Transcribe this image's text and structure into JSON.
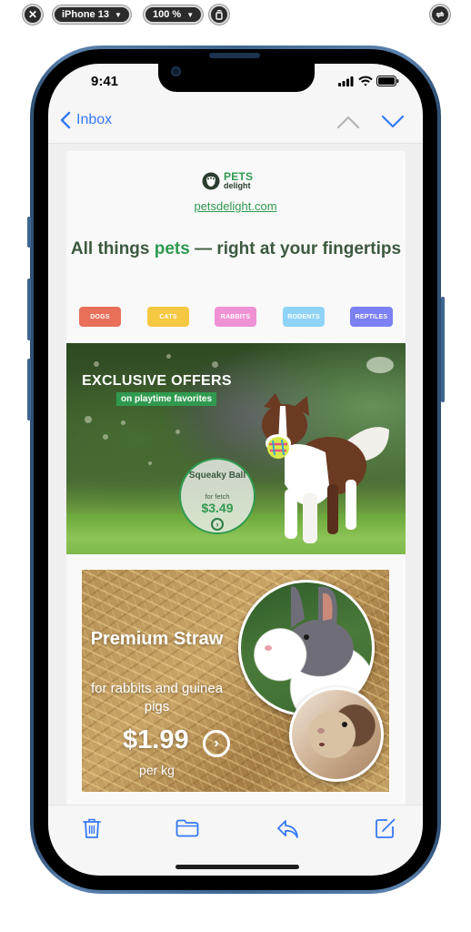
{
  "simulator": {
    "device_label": "iPhone 13",
    "zoom_label": "100 %",
    "close_icon": "close-icon",
    "rotate_icon": "rotate-icon",
    "sync_icon": "sync-icon"
  },
  "status_bar": {
    "time": "9:41",
    "icons": [
      "cellular-signal-icon",
      "wifi-icon",
      "battery-icon"
    ]
  },
  "nav": {
    "back_label": "Inbox",
    "prev_icon": "chevron-up-icon",
    "next_icon": "chevron-down-icon"
  },
  "email": {
    "brand": {
      "name_top": "PETS",
      "name_bottom": "delight",
      "link": "petsdelight.com"
    },
    "headline": {
      "before": "All things ",
      "highlight": "pets",
      "after": " — right at your fingertips"
    },
    "categories": [
      {
        "label": "DOGS",
        "color": "#e8705a"
      },
      {
        "label": "CATS",
        "color": "#f5c842"
      },
      {
        "label": "RABBITS",
        "color": "#ee92d4"
      },
      {
        "label": "RODENTS",
        "color": "#8fd3f7"
      },
      {
        "label": "REPTILES",
        "color": "#7b80f2"
      }
    ],
    "hero": {
      "title": "EXCLUSIVE OFFERS",
      "subtitle": "on playtime favorites",
      "product_name": "Squeaky Ball",
      "product_desc": "for fetch",
      "product_price": "$3.49",
      "arrow": "›"
    },
    "straw_offer": {
      "title": "Premium Straw",
      "subtitle": "for rabbits and guinea pigs",
      "price": "$1.99",
      "unit": "per kg",
      "arrow": "›"
    }
  },
  "toolbar": {
    "items": [
      "trash-icon",
      "folder-icon",
      "reply-icon",
      "compose-icon"
    ]
  },
  "colors": {
    "ios_blue": "#3478f6",
    "brand_green": "#2f9a4f",
    "brand_dark": "#3c5a40"
  }
}
